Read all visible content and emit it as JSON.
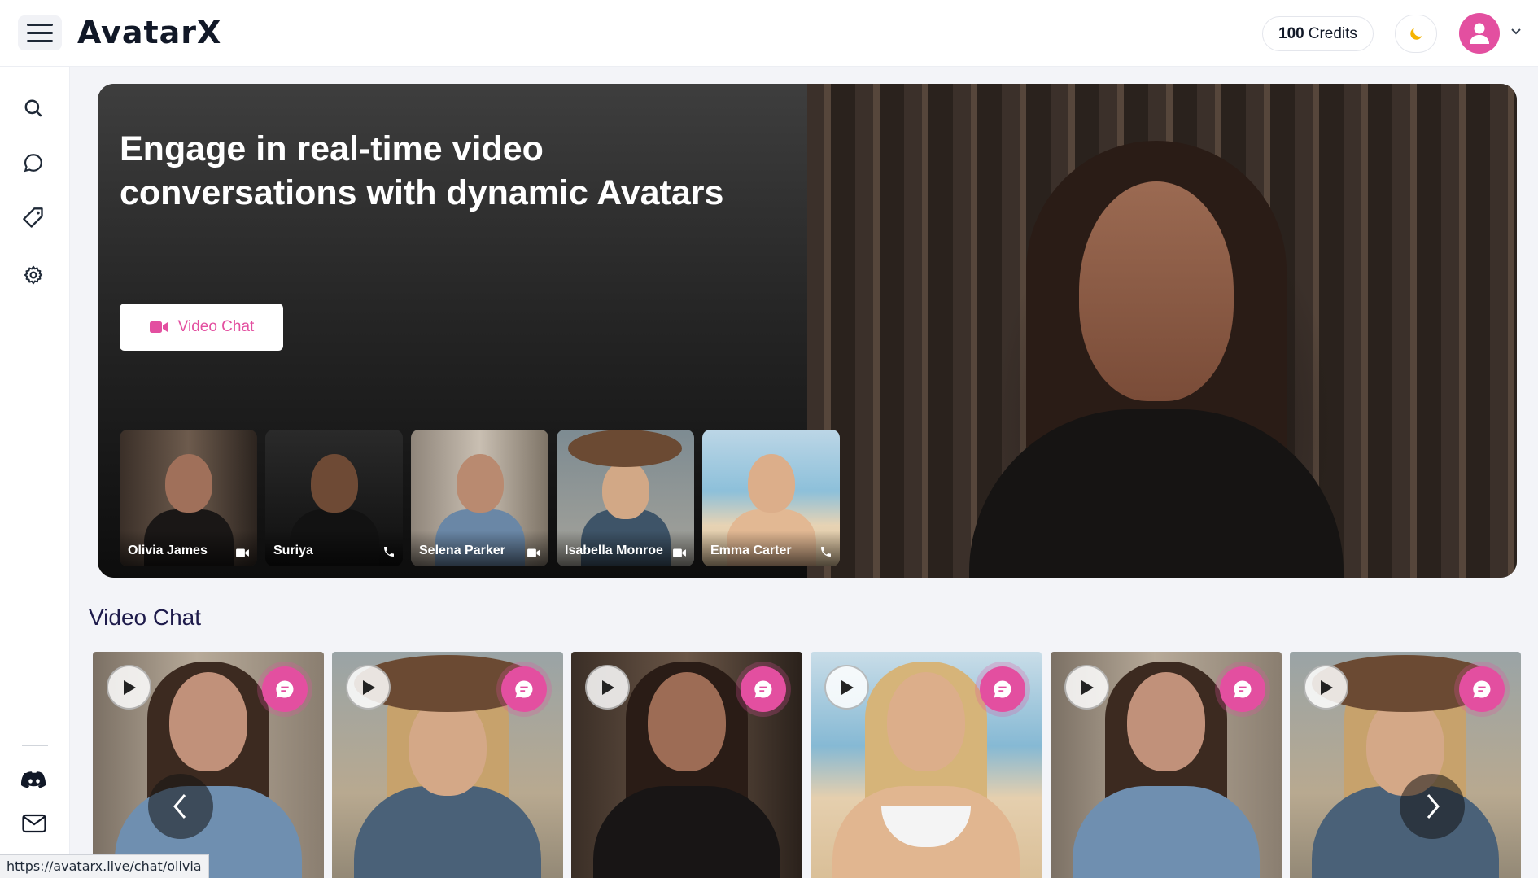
{
  "header": {
    "logo_text": "AvatarX",
    "credits_amount": "100",
    "credits_label": "Credits",
    "theme_icon": "moon-icon",
    "avatar_icon": "user-icon"
  },
  "sidebar": {
    "items": [
      {
        "name": "search",
        "icon": "search-icon"
      },
      {
        "name": "chat",
        "icon": "chat-bubble-icon"
      },
      {
        "name": "tags",
        "icon": "tag-icon"
      },
      {
        "name": "settings",
        "icon": "gear-icon"
      }
    ],
    "bottom": [
      {
        "name": "discord",
        "icon": "discord-icon"
      },
      {
        "name": "mail",
        "icon": "mail-icon"
      }
    ]
  },
  "hero": {
    "title": "Engage in real-time video conversations with dynamic Avatars",
    "cta_label": "Video Chat",
    "avatars": [
      {
        "name": "Olivia James",
        "mode": "video-icon"
      },
      {
        "name": "Suriya",
        "mode": "phone-icon"
      },
      {
        "name": "Selena Parker",
        "mode": "video-icon"
      },
      {
        "name": "Isabella Monroe",
        "mode": "video-icon"
      },
      {
        "name": "Emma Carter",
        "mode": "phone-icon"
      }
    ]
  },
  "section": {
    "title": "Video Chat"
  },
  "status_bar": {
    "url": "https://avatarx.live/chat/olivia"
  },
  "colors": {
    "accent": "#e34fa0",
    "heading": "#1e1b4b",
    "background": "#f3f4f8"
  }
}
